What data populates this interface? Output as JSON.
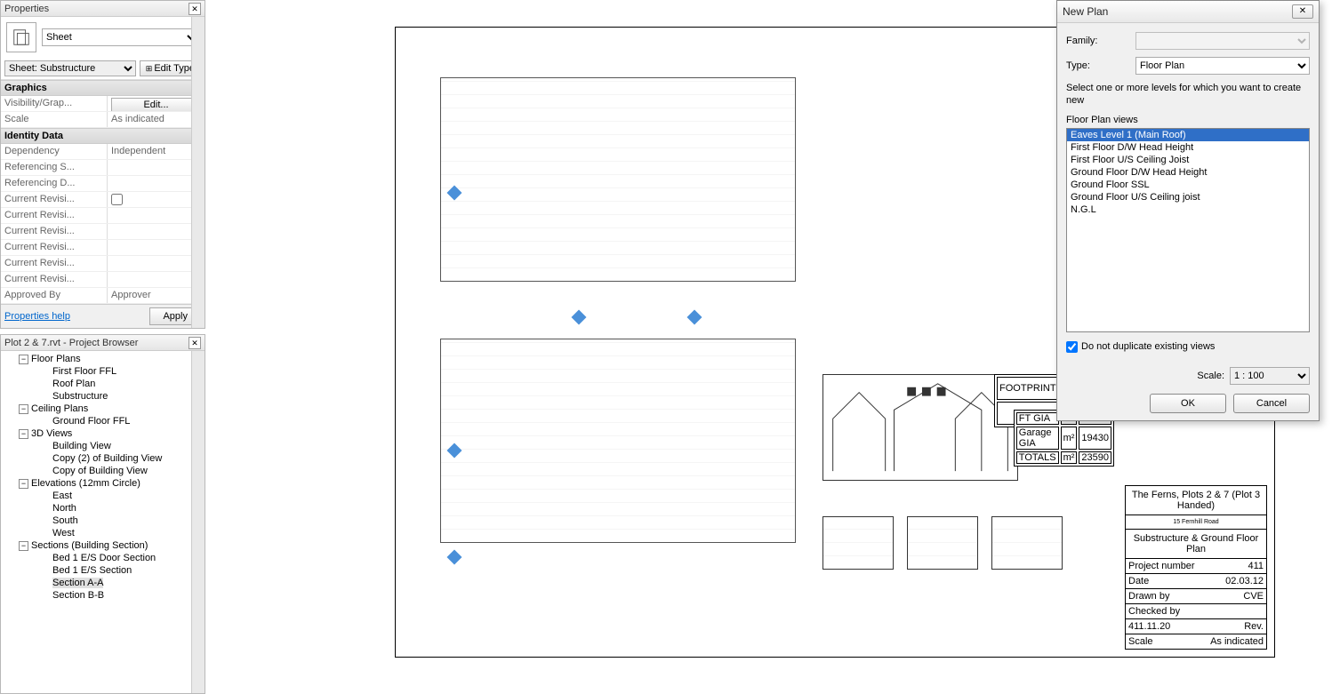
{
  "properties_panel": {
    "title": "Properties",
    "type_selector_label": "Sheet",
    "instance_selector_label": "Sheet: Substructure",
    "edit_type_label": "Edit Type",
    "groups": [
      {
        "name": "Graphics",
        "rows": [
          {
            "name": "Visibility/Grap...",
            "value_button": "Edit..."
          },
          {
            "name": "Scale",
            "value": "As indicated"
          }
        ]
      },
      {
        "name": "Identity Data",
        "rows": [
          {
            "name": "Dependency",
            "value": "Independent"
          },
          {
            "name": "Referencing S...",
            "value": ""
          },
          {
            "name": "Referencing D...",
            "value": ""
          },
          {
            "name": "Current Revisi...",
            "value_checkbox": false
          },
          {
            "name": "Current Revisi...",
            "value": ""
          },
          {
            "name": "Current Revisi...",
            "value": ""
          },
          {
            "name": "Current Revisi...",
            "value": ""
          },
          {
            "name": "Current Revisi...",
            "value": ""
          },
          {
            "name": "Current Revisi...",
            "value": ""
          },
          {
            "name": "Approved By",
            "value": "Approver"
          }
        ]
      }
    ],
    "help_link": "Properties help",
    "apply_button": "Apply"
  },
  "project_browser": {
    "title": "Plot 2 & 7.rvt - Project Browser",
    "tree": [
      {
        "level": 1,
        "expanded": true,
        "label": "Floor Plans"
      },
      {
        "level": 2,
        "label": "First Floor FFL"
      },
      {
        "level": 2,
        "label": "Roof Plan"
      },
      {
        "level": 2,
        "label": "Substructure"
      },
      {
        "level": 1,
        "expanded": true,
        "label": "Ceiling Plans"
      },
      {
        "level": 2,
        "label": "Ground Floor FFL"
      },
      {
        "level": 1,
        "expanded": true,
        "label": "3D Views"
      },
      {
        "level": 2,
        "label": "Building View"
      },
      {
        "level": 2,
        "label": "Copy (2) of Building View"
      },
      {
        "level": 2,
        "label": "Copy of Building View"
      },
      {
        "level": 1,
        "expanded": true,
        "label": "Elevations (12mm Circle)"
      },
      {
        "level": 2,
        "label": "East"
      },
      {
        "level": 2,
        "label": "North"
      },
      {
        "level": 2,
        "label": "South"
      },
      {
        "level": 2,
        "label": "West"
      },
      {
        "level": 1,
        "expanded": true,
        "label": "Sections (Building Section)"
      },
      {
        "level": 2,
        "label": "Bed 1 E/S Door Section"
      },
      {
        "level": 2,
        "label": "Bed 1 E/S Section"
      },
      {
        "level": 2,
        "label": "Section A-A",
        "selected": true
      },
      {
        "level": 2,
        "label": "Section B-B"
      }
    ]
  },
  "title_block": {
    "line1": "The Ferns, Plots 2 & 7 (Plot 3 Handed)",
    "line2": "15 Fernhill Road",
    "line3": "Substructure & Ground Floor Plan",
    "rows": [
      {
        "a": "Project number",
        "b": "411"
      },
      {
        "a": "Date",
        "b": "02.03.12"
      },
      {
        "a": "Drawn by",
        "b": "CVE"
      },
      {
        "a": "Checked by",
        "b": ""
      }
    ],
    "sheet_no": "411.11.20",
    "rev": "Rev.",
    "scale_label": "Scale",
    "scale": "As indicated"
  },
  "dialog": {
    "title": "New Plan",
    "family_label": "Family:",
    "family_value": "",
    "type_label": "Type:",
    "type_value": "Floor Plan",
    "instruction": "Select one or more levels for which you want to create new",
    "list_label": "Floor Plan views",
    "levels": [
      "Eaves Level 1 (Main Roof)",
      "First Floor D/W Head Height",
      "First Floor U/S Ceiling Joist",
      "Ground Floor D/W Head Height",
      "Ground Floor SSL",
      "Ground Floor U/S Ceiling joist",
      "N.G.L"
    ],
    "selected_level_index": 0,
    "duplicate_checkbox_label": "Do not duplicate existing views",
    "duplicate_checked": true,
    "scale_label": "Scale:",
    "scale_value": "1 : 100",
    "ok": "OK",
    "cancel": "Cancel"
  }
}
